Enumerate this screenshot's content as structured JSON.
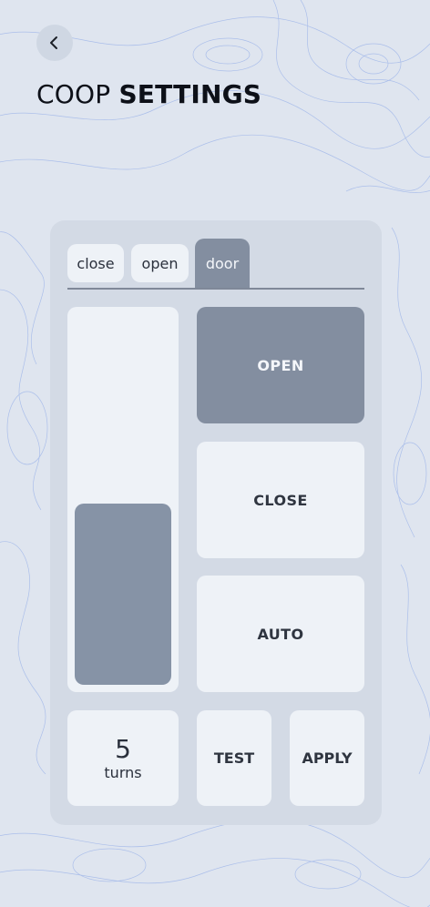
{
  "header": {
    "back_icon": "chevron-left-icon",
    "title_light": "COOP",
    "title_bold": "SETTINGS"
  },
  "tabs": [
    {
      "label": "close",
      "active": false
    },
    {
      "label": "open",
      "active": false
    },
    {
      "label": "door",
      "active": true
    }
  ],
  "door_position": {
    "fraction": 0.49
  },
  "controls": {
    "open_label": "OPEN",
    "close_label": "CLOSE",
    "auto_label": "AUTO",
    "active": "OPEN"
  },
  "turns": {
    "value": "5",
    "label": "turns"
  },
  "actions": {
    "test_label": "TEST",
    "apply_label": "APPLY"
  },
  "colors": {
    "background": "#dfe5ef",
    "panel": "#d3dae5",
    "tile": "#eef2f7",
    "accent": "#838ea0",
    "slider_fill": "#8693a6",
    "contour_lines": "#3f6fe0"
  }
}
